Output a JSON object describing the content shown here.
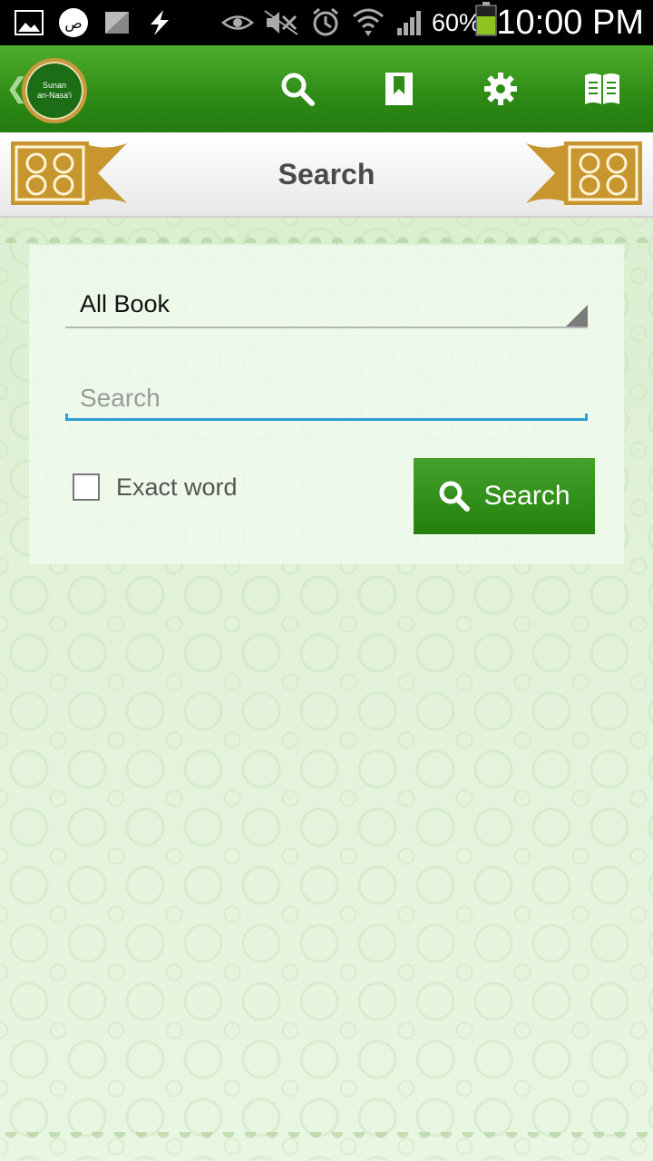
{
  "status_bar": {
    "battery_percent": "60%",
    "time": "10:00 PM",
    "icons": [
      "gallery-icon",
      "app-notification-icon",
      "screenshot-icon",
      "flash-icon",
      "eye-icon",
      "mute-icon",
      "alarm-icon",
      "wifi-icon",
      "signal-icon",
      "battery-icon"
    ]
  },
  "app_bar": {
    "logo_text_line1": "Sunan",
    "logo_text_line2": "an-Nasa'i",
    "actions": [
      "search-icon",
      "bookmark-icon",
      "gear-icon",
      "book-icon"
    ]
  },
  "header": {
    "title": "Search"
  },
  "search_form": {
    "scope_selected": "All Book",
    "input_placeholder": "Search",
    "input_value": "",
    "exact_word_label": "Exact word",
    "exact_word_checked": false,
    "submit_label": "Search"
  },
  "colors": {
    "brand_green": "#2f8d16",
    "input_accent": "#2d9fd6",
    "ornament_gold": "#c8962e"
  }
}
